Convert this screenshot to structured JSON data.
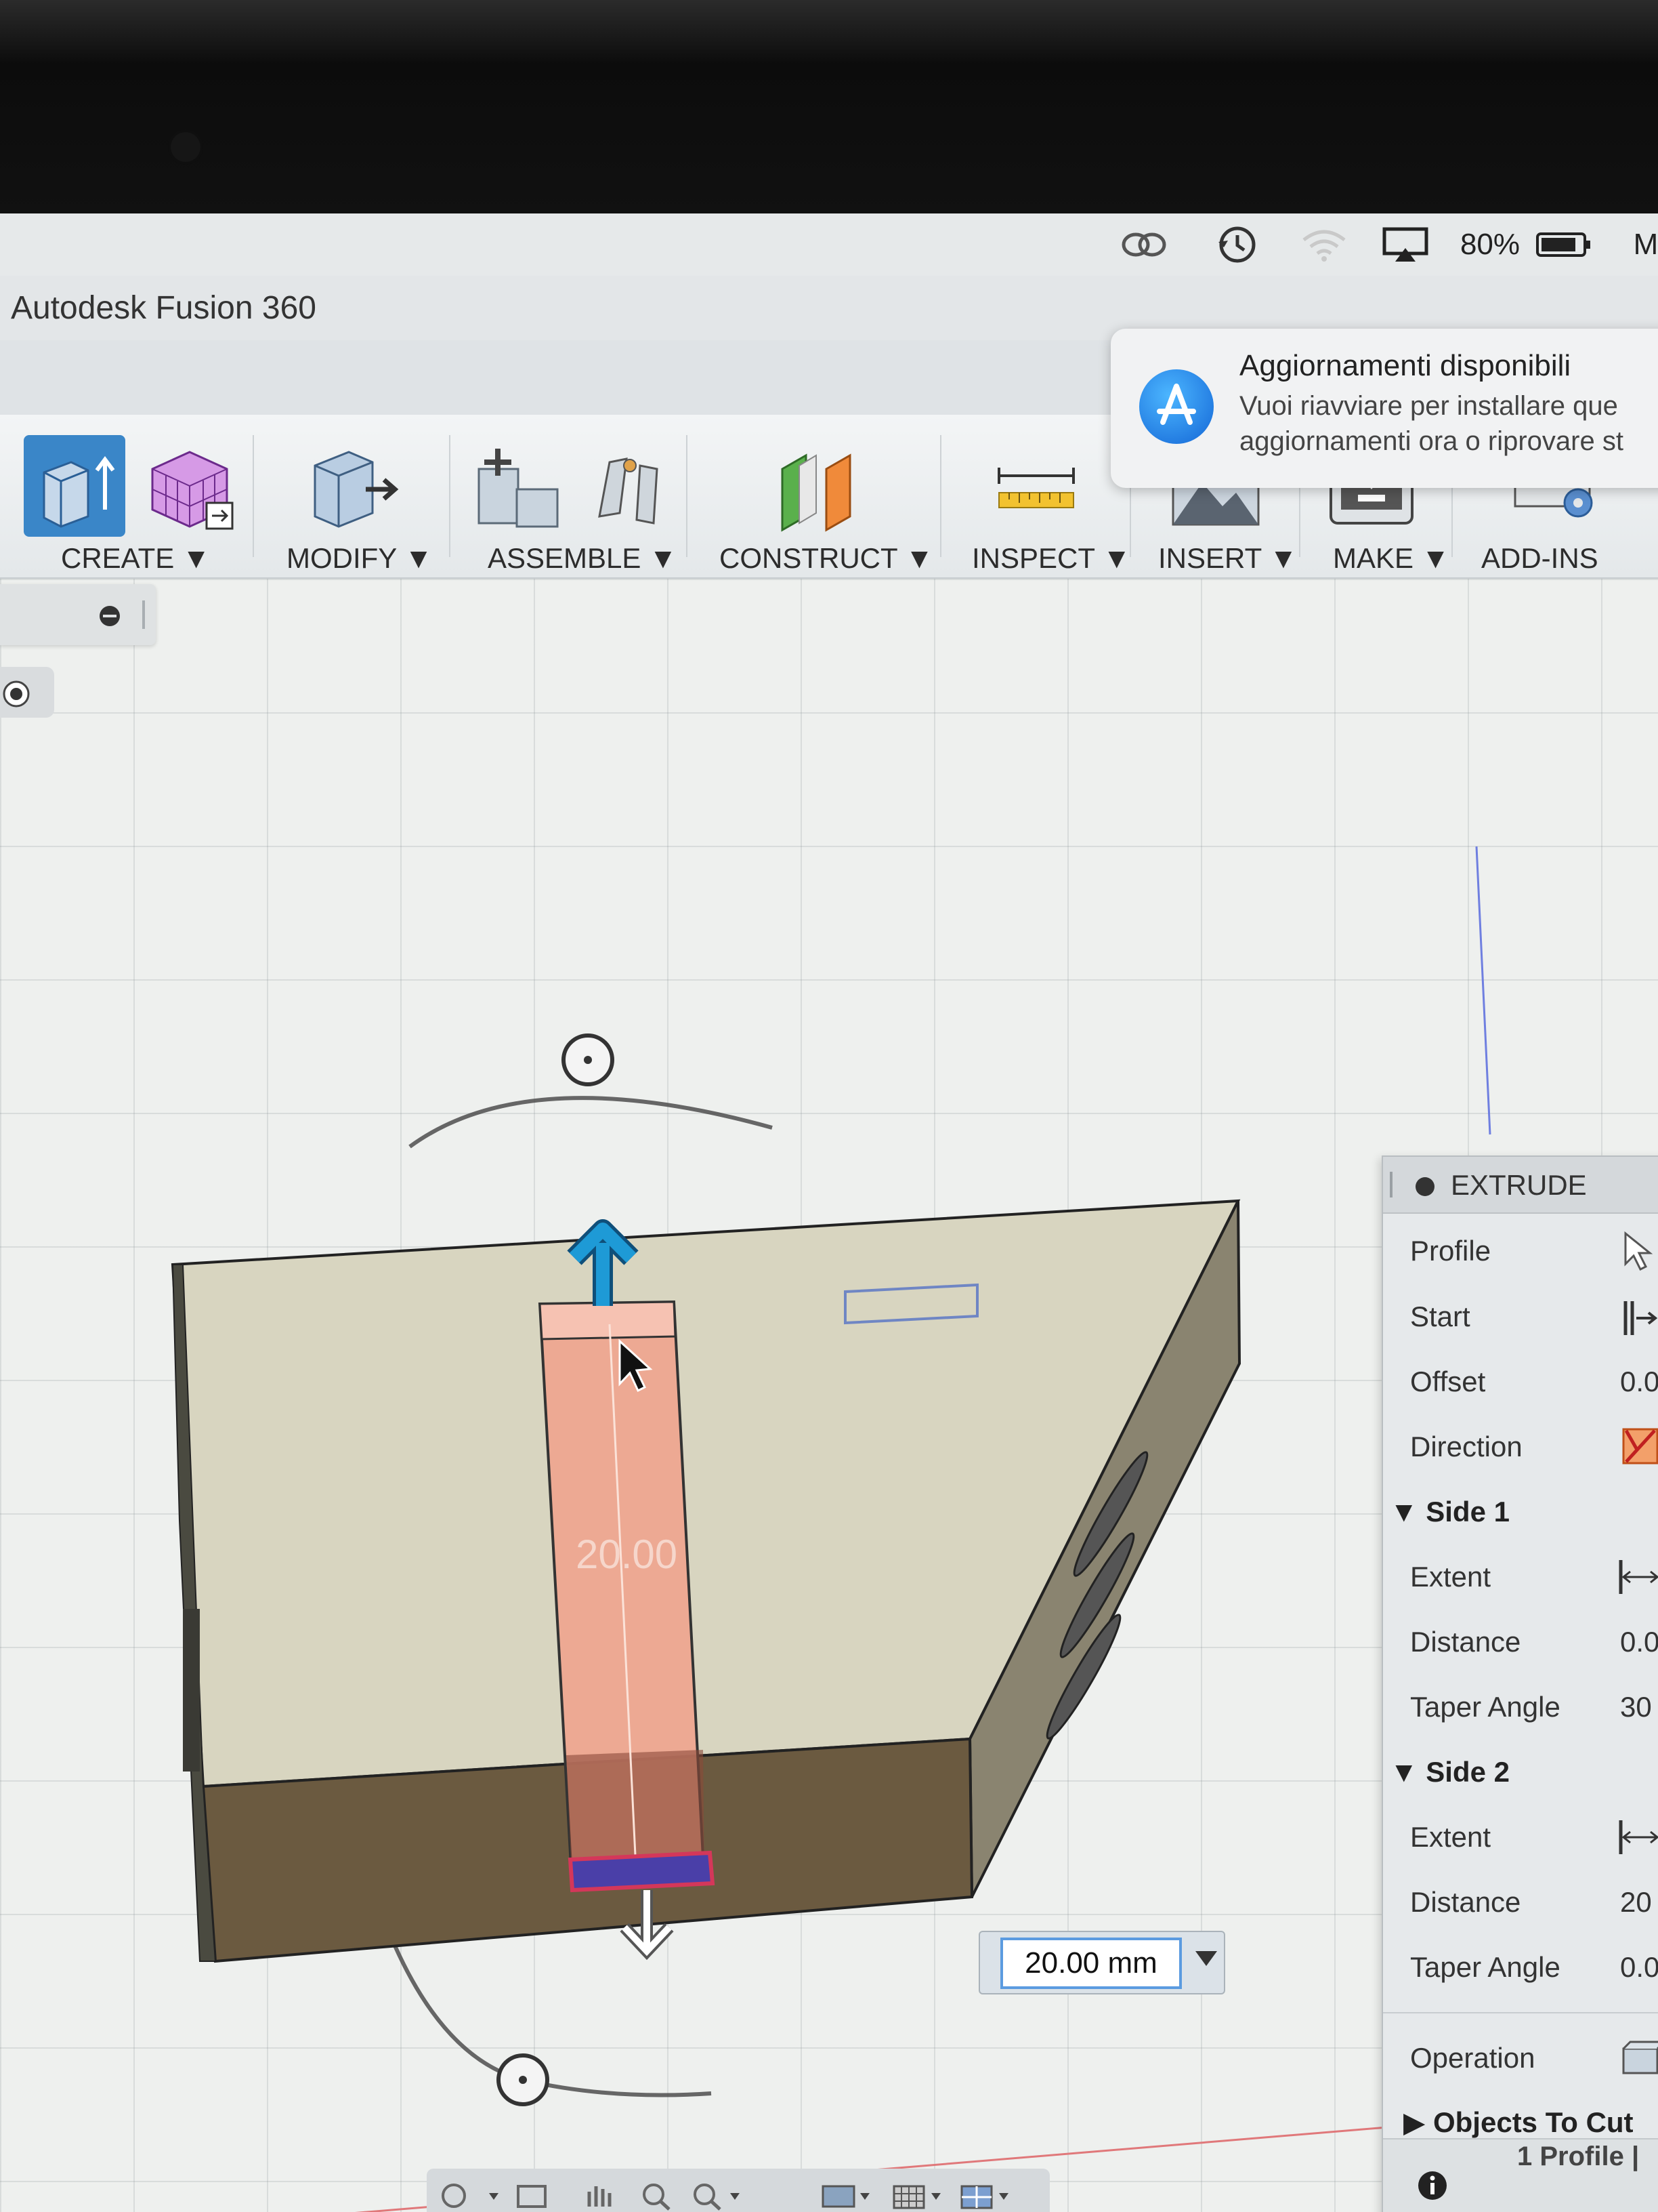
{
  "menubar": {
    "battery_percent": "80%",
    "cutoff_letter": "M",
    "icons": [
      "creative-cloud-icon",
      "time-machine-icon",
      "wifi-icon",
      "airplay-icon",
      "battery-icon"
    ]
  },
  "app": {
    "title": "Autodesk Fusion 360"
  },
  "notification": {
    "title": "Aggiornamenti disponibili",
    "line1": "Vuoi riavviare per installare que",
    "line2": "aggiornamenti ora o riprovare st"
  },
  "toolbar": {
    "groups": [
      {
        "label": "CREATE",
        "dropdown": true
      },
      {
        "label": "MODIFY",
        "dropdown": true
      },
      {
        "label": "ASSEMBLE",
        "dropdown": true
      },
      {
        "label": "CONSTRUCT",
        "dropdown": true
      },
      {
        "label": "INSPECT",
        "dropdown": true
      },
      {
        "label": "INSERT",
        "dropdown": true
      },
      {
        "label": "MAKE",
        "dropdown": true
      },
      {
        "label": "ADD-INS",
        "dropdown": false
      }
    ],
    "dropdown_glyph": "▼"
  },
  "viewport": {
    "dimension_label": "20.00",
    "dimension_input": "20.00 mm"
  },
  "extrude": {
    "title": "EXTRUDE",
    "rows": [
      {
        "label": "Profile",
        "value": ""
      },
      {
        "label": "Start",
        "value": ""
      },
      {
        "label": "Offset",
        "value": "0.0"
      },
      {
        "label": "Direction",
        "value": ""
      }
    ],
    "side1": {
      "title": "Side 1",
      "rows": [
        {
          "label": "Extent",
          "value": ""
        },
        {
          "label": "Distance",
          "value": "0.0"
        },
        {
          "label": "Taper Angle",
          "value": "30"
        }
      ]
    },
    "side2": {
      "title": "Side 2",
      "rows": [
        {
          "label": "Extent",
          "value": ""
        },
        {
          "label": "Distance",
          "value": "20"
        },
        {
          "label": "Taper Angle",
          "value": "0.0"
        }
      ]
    },
    "operation": "Operation",
    "objects_to_cut": "Objects To Cut"
  },
  "status": {
    "profile_count": "1 Profile |"
  },
  "colors": {
    "active_tool": "#3a86c8",
    "body_top": "#d8d5c0",
    "body_front": "#6b5a40",
    "profile_fill": "#f0a48e",
    "arrow_blue": "#1e9ad6"
  }
}
